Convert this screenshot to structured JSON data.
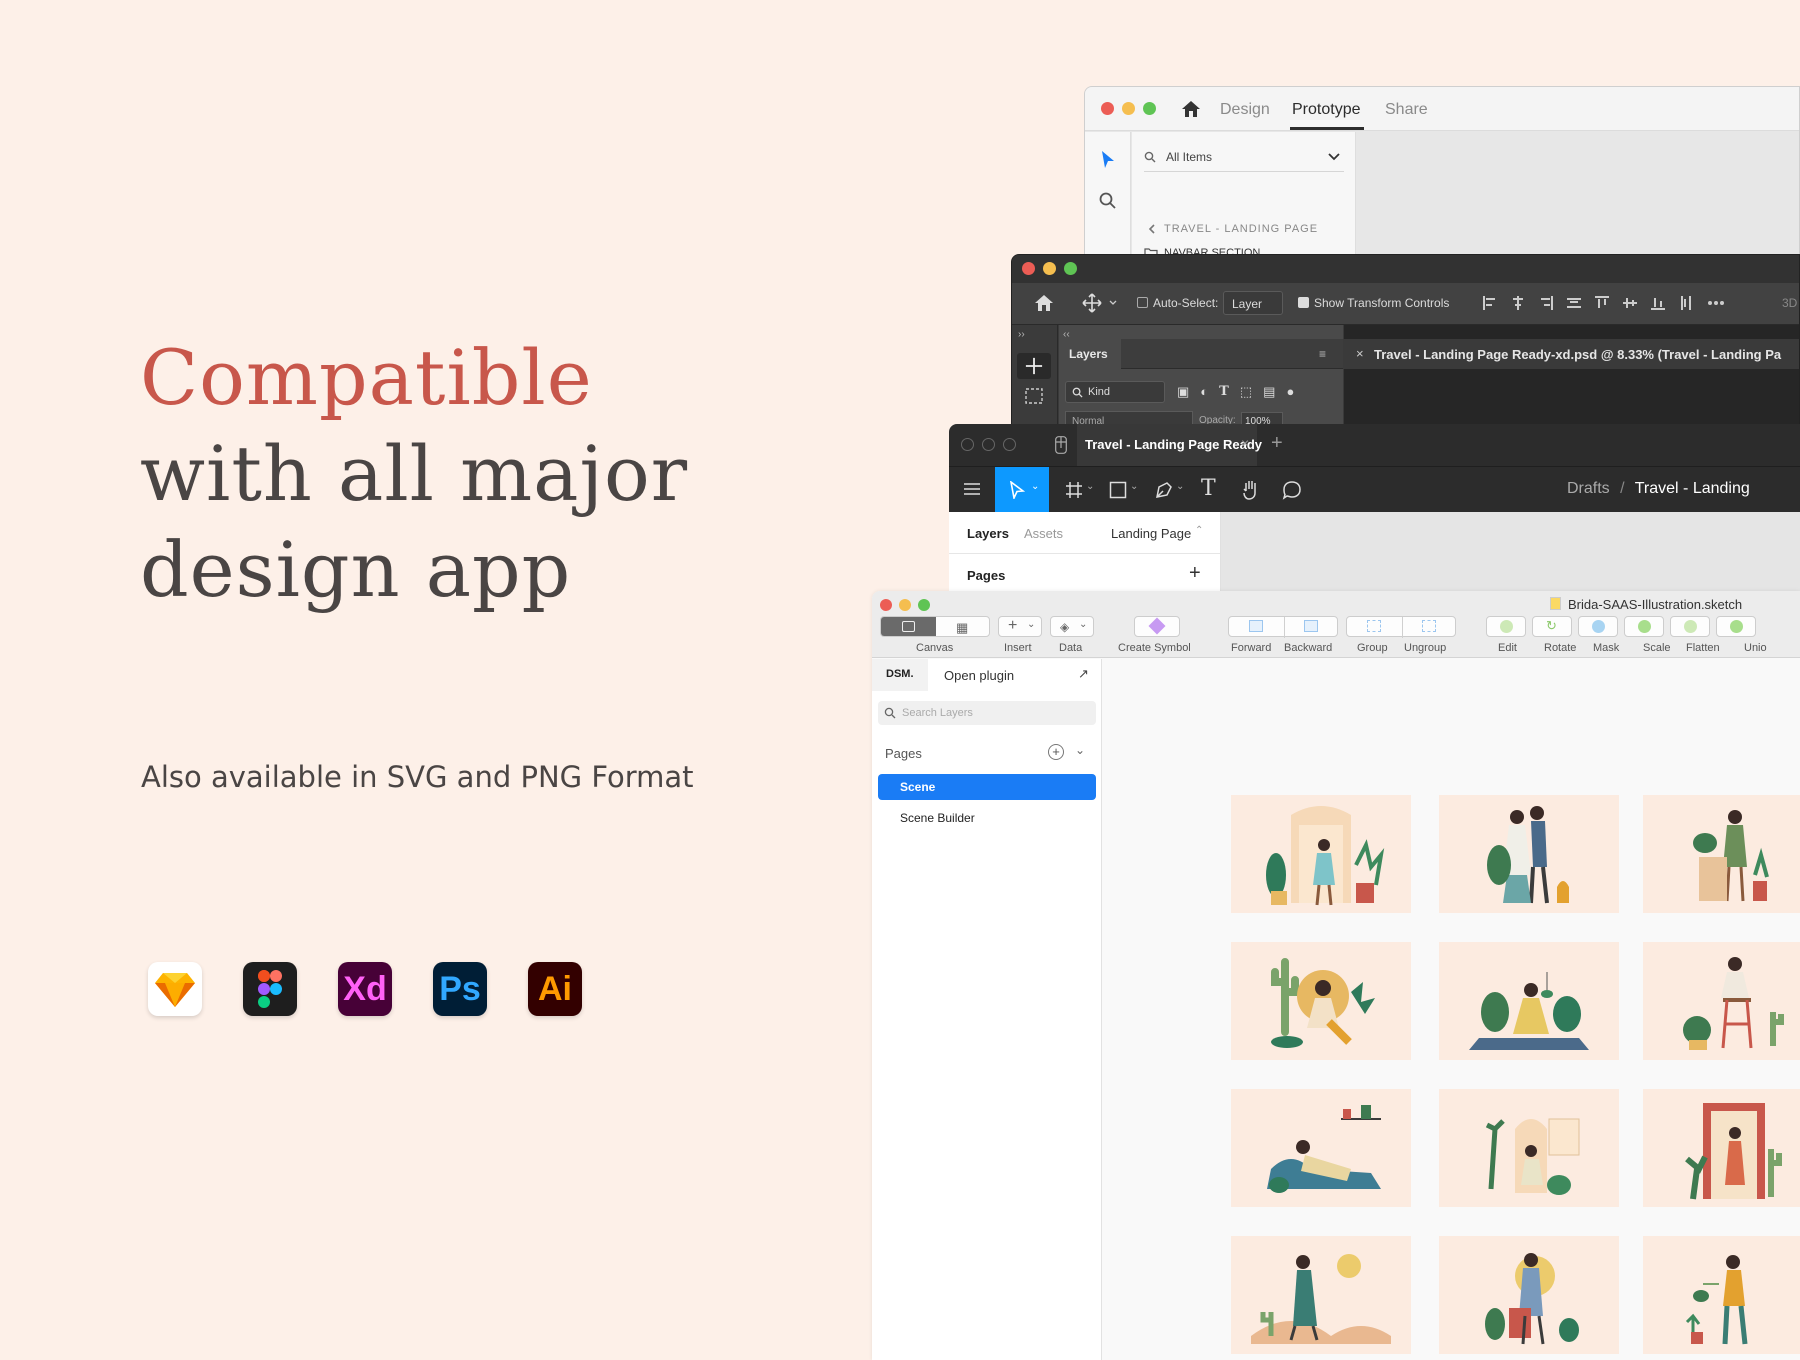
{
  "hero": {
    "title_accent": "Compatible",
    "title_line2": "with all major",
    "title_line3": "design app",
    "subtitle": "Also available in SVG and PNG Format"
  },
  "app_icons": [
    {
      "name": "sketch-icon",
      "label": ""
    },
    {
      "name": "figma-icon",
      "label": ""
    },
    {
      "name": "xd-icon",
      "label": "Xd"
    },
    {
      "name": "photoshop-icon",
      "label": "Ps"
    },
    {
      "name": "illustrator-icon",
      "label": "Ai"
    }
  ],
  "xd": {
    "tabs": [
      "Design",
      "Prototype",
      "Share"
    ],
    "search_label": "All Items",
    "breadcrumb": "TRAVEL - LANDING PAGE",
    "folder": "NAVBAR SECTION"
  },
  "photoshop": {
    "auto_select": "Auto-Select:",
    "layer_dropdown": "Layer",
    "transform": "Show Transform Controls",
    "doc_tab": "Travel - Landing Page Ready-xd.psd @ 8.33% (Travel - Landing Pa",
    "layers_tab": "Layers",
    "kind": "Kind",
    "blend": "Normal",
    "opacity_label": "Opacity:",
    "opacity_value": "100%",
    "more_label": "3D"
  },
  "figma": {
    "file_tab": "Travel - Landing Page Ready",
    "breadcrumb_root": "Drafts",
    "breadcrumb_sep": "/",
    "breadcrumb_file": "Travel - Landing",
    "tab_layers": "Layers",
    "tab_assets": "Assets",
    "page_select": "Landing Page",
    "pages_label": "Pages"
  },
  "sketch": {
    "filename": "Brida-SAAS-Illustration.sketch",
    "toolbar": [
      "Canvas",
      "Insert",
      "Data",
      "Create Symbol",
      "Forward",
      "Backward",
      "Group",
      "Ungroup",
      "Edit",
      "Rotate",
      "Mask",
      "Scale",
      "Flatten",
      "Unio"
    ],
    "dsm": "DSM.",
    "open_plugin": "Open plugin",
    "search_placeholder": "Search Layers",
    "pages_label": "Pages",
    "pages": [
      "Scene",
      "Scene Builder"
    ]
  },
  "colors": {
    "background": "#fdf0e8",
    "accent": "#c8574b",
    "text": "#4a4544",
    "selection_blue": "#1a7cf5"
  }
}
